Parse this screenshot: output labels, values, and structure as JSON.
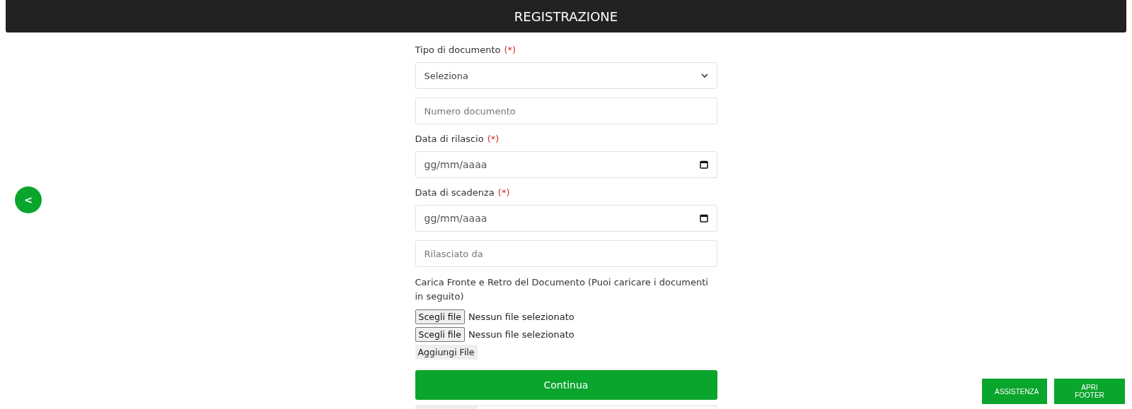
{
  "header": {
    "title": "REGISTRAZIONE"
  },
  "back_button": {
    "label": "<"
  },
  "form": {
    "fields": [
      {
        "kind": "select",
        "label": "Tipo di documento",
        "required_mark": "(*)",
        "value": "Seleziona"
      },
      {
        "kind": "text",
        "placeholder": "Numero documento"
      },
      {
        "kind": "date",
        "label": "Data di rilascio",
        "required_mark": "(*)",
        "placeholder": "gg/mm/aaaa"
      },
      {
        "kind": "date",
        "label": "Data di scadenza",
        "required_mark": "(*)",
        "placeholder": "gg/mm/aaaa"
      },
      {
        "kind": "text",
        "placeholder": "Rilasciato da"
      }
    ],
    "upload_note": "Carica Fronte e Retro del Documento (Puoi caricare i documenti in seguito)",
    "file_inputs": [
      {
        "button": "Scegli file",
        "status": "Nessun file selezionato"
      },
      {
        "button": "Scegli file",
        "status": "Nessun file selezionato"
      }
    ],
    "add_file": "Aggiungi File",
    "submit": "Continua"
  },
  "corner_buttons": [
    "ASSISTENZA",
    "APRI FOOTER"
  ]
}
